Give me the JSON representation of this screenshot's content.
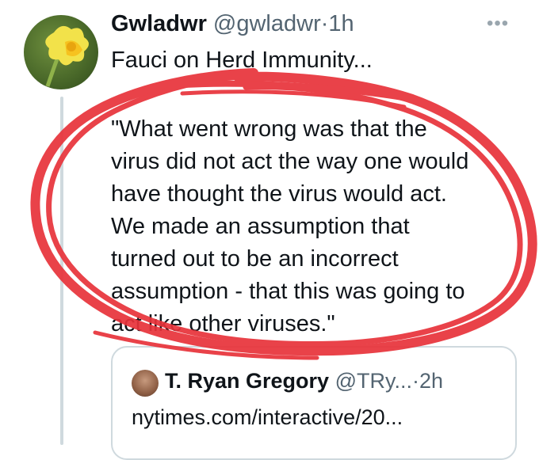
{
  "tweet": {
    "author_name": "Gwladwr",
    "author_handle": "@gwladwr",
    "separator": "·",
    "time": "1h",
    "text_line1": "Fauci on Herd Immunity...",
    "quote_lines": [
      "\"What went wrong was that the",
      "virus did not act the way one would",
      "have thought the virus would act.",
      "We made an assumption that",
      "turned out to be an incorrect",
      "assumption - that this was going to",
      "act like other viruses.\""
    ],
    "more_icon": "more-horizontal-icon"
  },
  "quoted_tweet": {
    "author_name": "T. Ryan Gregory",
    "author_handle": "@TRy...",
    "separator": "·",
    "time": "2h",
    "link_text": "nytimes.com/interactive/20..."
  },
  "colors": {
    "scribble": "#e8323a",
    "thread_line": "#cfd9de",
    "secondary_text": "#536471"
  }
}
